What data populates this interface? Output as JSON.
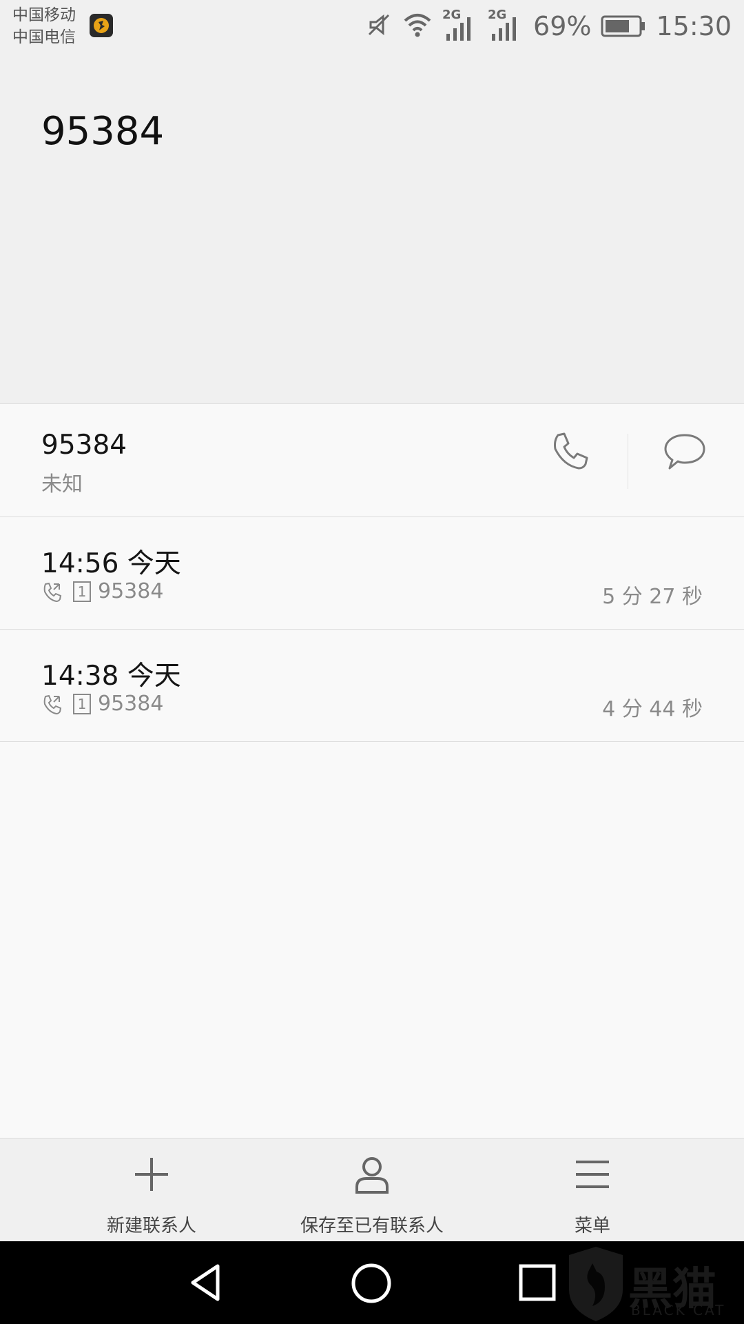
{
  "status_bar": {
    "carrier_1": "中国移动",
    "carrier_2": "中国电信",
    "network_1": "2G",
    "network_2": "2G",
    "battery": "69%",
    "time": "15:30",
    "icons": [
      "mute-icon",
      "wifi-icon",
      "signal-icon",
      "signal-icon",
      "battery-icon"
    ]
  },
  "header": {
    "number": "95384"
  },
  "contact_row": {
    "number": "95384",
    "label": "未知",
    "call_icon": "phone-icon",
    "message_icon": "message-icon"
  },
  "call_log": [
    {
      "time": "14:56 今天",
      "sim": "1",
      "number": "95384",
      "duration": "5 分 27 秒"
    },
    {
      "time": "14:38 今天",
      "sim": "1",
      "number": "95384",
      "duration": "4 分 44 秒"
    }
  ],
  "bottom_bar": {
    "new_contact": "新建联系人",
    "save_existing": "保存至已有联系人",
    "menu": "菜单"
  },
  "watermark": {
    "text": "黑猫",
    "sub": "BLACK CAT"
  },
  "colors": {
    "header_bg": "#f0f0f0",
    "body_bg": "#f9f9f9",
    "nav_bg": "#000000"
  }
}
